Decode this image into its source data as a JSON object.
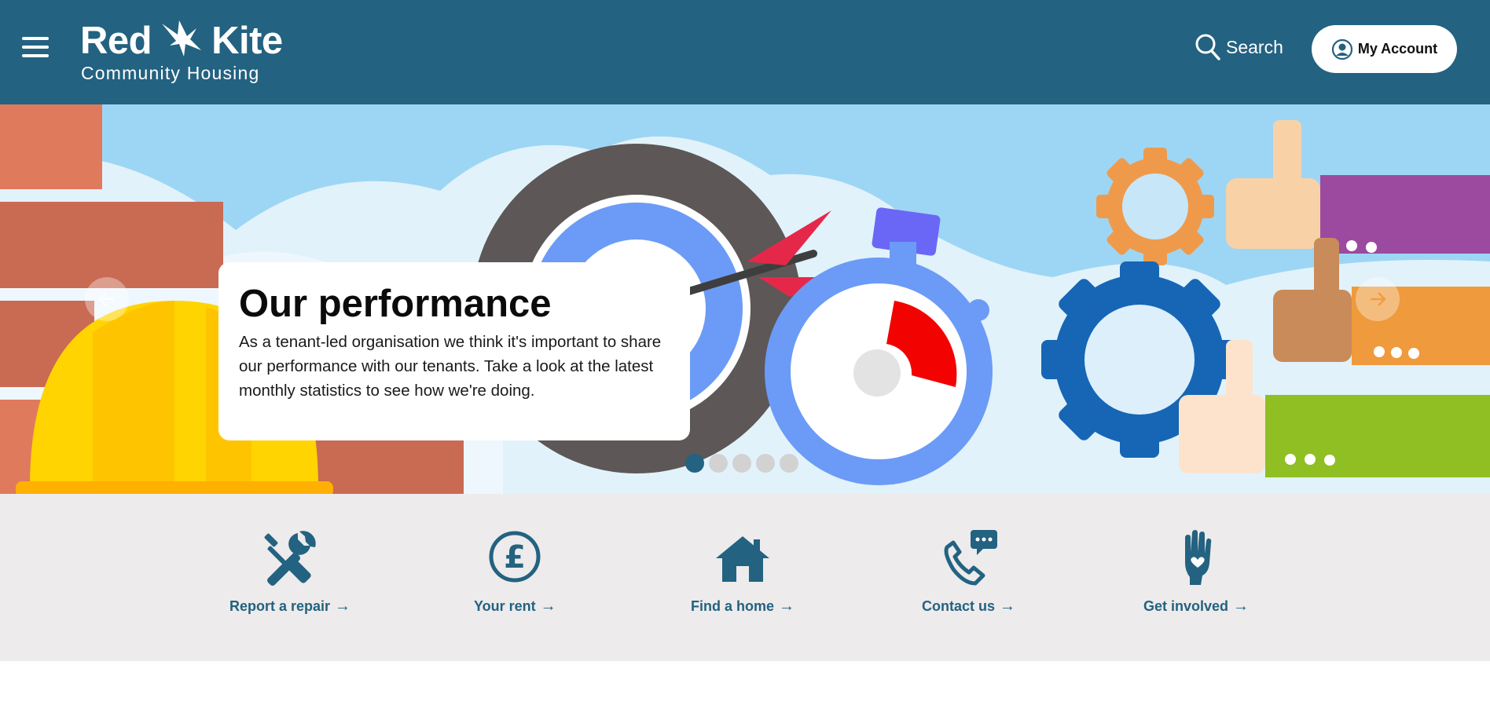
{
  "header": {
    "menu_icon": "hamburger-menu-icon",
    "logo": {
      "word1": "Red",
      "word2": "Kite",
      "subtitle": "Community Housing"
    },
    "search_label": "Search",
    "account_label": "My Account"
  },
  "hero": {
    "title": "Our performance",
    "body": "As a tenant-led organisation we think it's important to share our performance with our tenants. Take a look at the latest monthly statistics to see how we're doing.",
    "slides_total": 5,
    "active_slide": 1
  },
  "quick_links": [
    {
      "label": "Report a repair",
      "icon": "tools-icon"
    },
    {
      "label": "Your rent",
      "icon": "pound-coin-icon"
    },
    {
      "label": "Find a home",
      "icon": "house-icon"
    },
    {
      "label": "Contact us",
      "icon": "phone-chat-icon"
    },
    {
      "label": "Get involved",
      "icon": "hand-heart-icon"
    }
  ],
  "colors": {
    "brand": "#236281",
    "quicklinks_bg": "#edebeb",
    "sky": "#9dd6f4"
  }
}
